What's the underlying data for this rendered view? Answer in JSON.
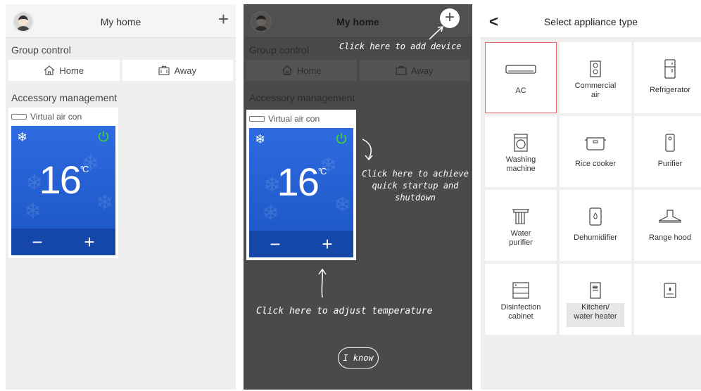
{
  "panel1": {
    "title": "My home",
    "plus": "+",
    "group_control": "Group control",
    "group_buttons": [
      "Home",
      "Away"
    ],
    "accessory_management": "Accessory management",
    "device_name": "Virtual air con",
    "temperature": "16",
    "unit": "°C",
    "minus": "−",
    "plus_ctrl": "+"
  },
  "panel2": {
    "title": "My home",
    "plus": "+",
    "group_control": "Group control",
    "group_buttons": [
      "Home",
      "Away"
    ],
    "accessory_management": "Accessory management",
    "device_name": "Virtual air con",
    "temperature": "16",
    "unit": "°C",
    "minus": "−",
    "plus_ctrl": "+",
    "hint_add_device": "Click here to add device",
    "hint_power_1": "Click here to achieve",
    "hint_power_2": "quick startup and",
    "hint_power_3": "shutdown",
    "hint_temperature": "Click here to adjust temperature",
    "i_know": "I know"
  },
  "panel3": {
    "title": "Select appliance type",
    "back": "<",
    "appliances": [
      {
        "line1": "AC",
        "line2": "",
        "icon": "ac-icon"
      },
      {
        "line1": "Commercial",
        "line2": "air",
        "icon": "commercial-air-icon"
      },
      {
        "line1": "Refrigerator",
        "line2": "",
        "icon": "refrigerator-icon"
      },
      {
        "line1": "Washing",
        "line2": "machine",
        "icon": "washing-machine-icon"
      },
      {
        "line1": "Rice cooker",
        "line2": "",
        "icon": "rice-cooker-icon"
      },
      {
        "line1": "Purifier",
        "line2": "",
        "icon": "purifier-icon"
      },
      {
        "line1": "Water",
        "line2": "purifier",
        "icon": "water-purifier-icon"
      },
      {
        "line1": "Dehumidifier",
        "line2": "",
        "icon": "dehumidifier-icon"
      },
      {
        "line1": "Range hood",
        "line2": "",
        "icon": "range-hood-icon"
      },
      {
        "line1": "Disinfection",
        "line2": "cabinet",
        "icon": "disinfection-cabinet-icon"
      },
      {
        "line1": "Kitchen/",
        "line2": "water heater",
        "icon": "kitchen-water-heater-icon"
      },
      {
        "line1": "",
        "line2": "",
        "icon": "water-heater-icon"
      }
    ],
    "selected_color": "#e26a6a"
  },
  "colors": {
    "ac_blue": "#2e6be0",
    "ac_control": "#1547a8",
    "power_green": "#3ecf3e"
  }
}
